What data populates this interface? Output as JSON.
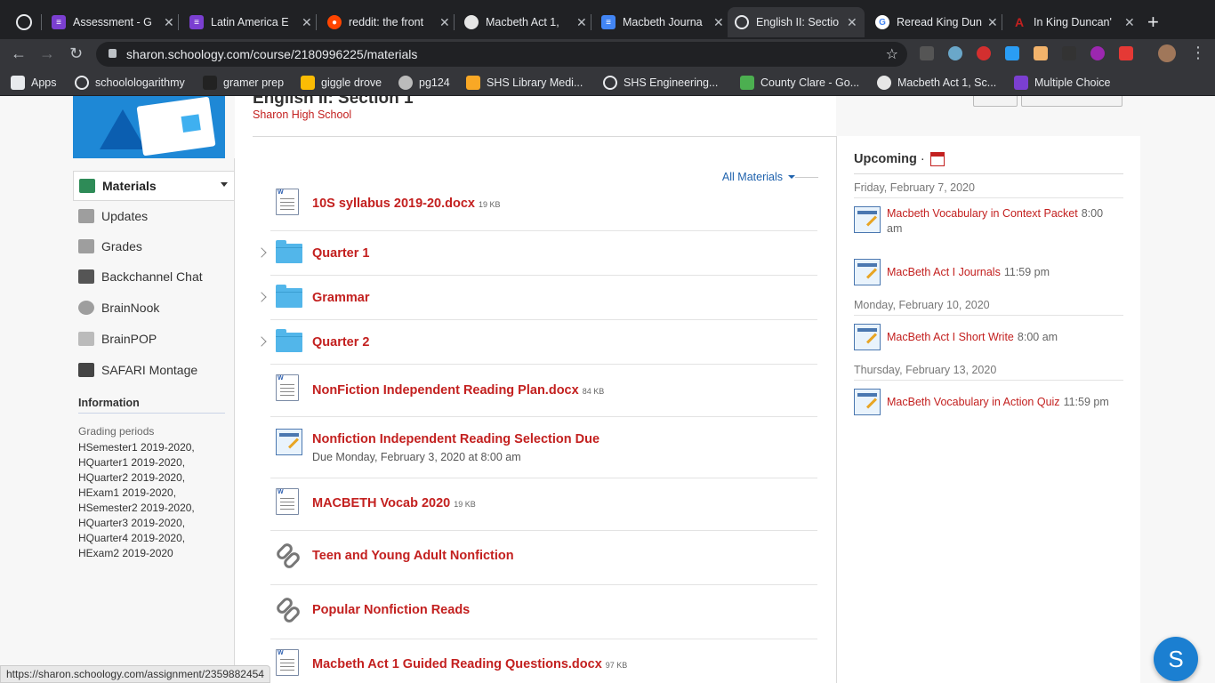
{
  "browser": {
    "tabs": [
      {
        "title": "Assessment - G",
        "color": "#7b3fd1"
      },
      {
        "title": "Latin America E",
        "color": "#7b3fd1"
      },
      {
        "title": "reddit: the front",
        "color": "#ff4500"
      },
      {
        "title": "Macbeth Act 1,",
        "color": "#e6e6e6"
      },
      {
        "title": "Macbeth Journa",
        "color": "#4285f4"
      },
      {
        "title": "English II: Sectio",
        "color": "#35363a"
      },
      {
        "title": "Reread King Dun",
        "color": "#ffffff"
      },
      {
        "title": "In King Duncan'",
        "color": "#c3201f"
      }
    ],
    "url": "sharon.schoology.com/course/2180996225/materials",
    "bookmarks": [
      "Apps",
      "schoolologarithmy",
      "gramer prep",
      "giggle drove",
      "pg124",
      "SHS Library Medi...",
      "SHS Engineering...",
      "County Clare - Go...",
      "Macbeth Act 1, Sc...",
      "Multiple Choice"
    ]
  },
  "course": {
    "title": "English II: Section 1",
    "school": "Sharon High School"
  },
  "nav": {
    "items": [
      "Materials",
      "Updates",
      "Grades",
      "Backchannel Chat",
      "BrainNook",
      "BrainPOP",
      "SAFARI Montage"
    ],
    "info_heading": "Information",
    "grading_label": "Grading periods",
    "grading_periods": [
      "HSemester1 2019-2020,",
      "HQuarter1 2019-2020,",
      "HQuarter2 2019-2020,",
      "HExam1 2019-2020,",
      "HSemester2 2019-2020,",
      "HQuarter3 2019-2020,",
      "HQuarter4 2019-2020,",
      "HExam2 2019-2020"
    ]
  },
  "materials": {
    "filter_label": "All Materials",
    "items": [
      {
        "title": "10S syllabus 2019-20.docx",
        "size": "19 KB",
        "type": "doc"
      },
      {
        "title": "Quarter 1",
        "type": "folder"
      },
      {
        "title": "Grammar",
        "type": "folder"
      },
      {
        "title": "Quarter 2",
        "type": "folder"
      },
      {
        "title": "NonFiction Independent Reading Plan.docx",
        "size": "84 KB",
        "type": "doc"
      },
      {
        "title": "Nonfiction Independent Reading Selection Due",
        "sub": "Due Monday, February 3, 2020 at 8:00 am",
        "type": "assignment"
      },
      {
        "title": "MACBETH Vocab 2020",
        "size": "19 KB",
        "type": "doc"
      },
      {
        "title": "Teen and Young Adult Nonfiction",
        "type": "link"
      },
      {
        "title": "Popular Nonfiction Reads",
        "type": "link"
      },
      {
        "title": "Macbeth Act 1 Guided Reading Questions.docx",
        "size": "97 KB",
        "type": "doc"
      }
    ]
  },
  "upcoming": {
    "heading": "Upcoming",
    "sep": "·",
    "groups": [
      {
        "date": "Friday, February 7, 2020",
        "items": [
          {
            "title": "Macbeth Vocabulary in Context Packet",
            "time": "8:00 am"
          },
          {
            "title": "MacBeth Act I Journals",
            "time": "11:59 pm"
          }
        ]
      },
      {
        "date": "Monday, February 10, 2020",
        "items": [
          {
            "title": "MacBeth Act I Short Write",
            "time": "8:00 am"
          }
        ]
      },
      {
        "date": "Thursday, February 13, 2020",
        "items": [
          {
            "title": "MacBeth Vocabulary in Action Quiz",
            "time": "11:59 pm"
          }
        ]
      }
    ]
  },
  "status_url": "https://sharon.schoology.com/assignment/2359882454",
  "fab_label": "S"
}
